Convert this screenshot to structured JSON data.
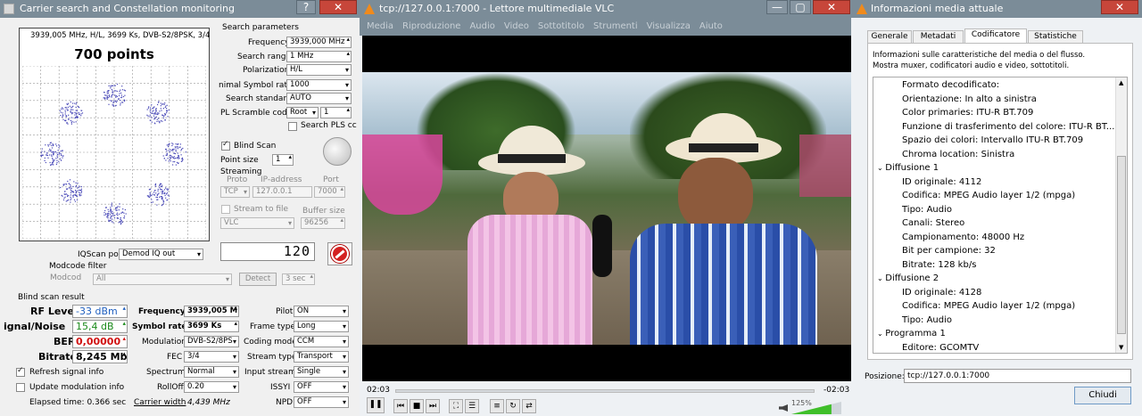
{
  "tbs": {
    "title": "Carrier search and Constellation monitoring",
    "help": "?",
    "close": "✕",
    "constellation": {
      "header": "3939,005 MHz, H/L, 3699 Ks, DVB-S2/8PSK, 3/4",
      "points": "700 points"
    },
    "search_params": {
      "title": "Search parameters",
      "frequency_label": "Frequency",
      "frequency": "3939,000 MHz",
      "search_range_label": "Search range",
      "search_range": "1 MHz",
      "polarization_label": "Polarization",
      "polarization": "H/L",
      "symbol_rate_label": "nimal Symbol rate",
      "symbol_rate": "1000",
      "search_standard_label": "Search standard",
      "search_standard": "AUTO",
      "pl_scramble_label": "PL Scramble code",
      "pl_scramble_type": "Root",
      "pl_scramble_value": "1",
      "search_pls_label": "Search PLS cc"
    },
    "blind_scan_label": "Blind Scan",
    "point_size_label": "Point size",
    "point_size": "1",
    "streaming": {
      "title": "Streaming",
      "proto_label": "Proto",
      "ip_label": "IP-address",
      "port_label": "Port",
      "proto": "TCP",
      "ip": "127.0.0.1",
      "port": "7000",
      "stream_to_file_label": "Stream to file",
      "buffer_size_label": "Buffer size",
      "player": "VLC",
      "buffer_size": "96256"
    },
    "display_value": "120",
    "iqscan_label": "IQScan point",
    "iqscan_value": "Demod IQ out",
    "modcode_filter_title": "Modcode filter",
    "modcode_label": "Modcod",
    "modcode_value": "All",
    "detect_label": "Detect",
    "detect_time": "3 sec",
    "result_title": "Blind scan result",
    "rf_level_label": "RF Level",
    "rf_level": "-33 dBm",
    "snr_label": "ignal/Noise",
    "snr": "15,4 dB",
    "ber_label": "BER",
    "ber": "0,00000",
    "bitrate_label": "Bitrate",
    "bitrate": "8,245 Mb",
    "refresh_label": "Refresh signal info",
    "update_mod_label": "Update modulation info",
    "elapsed": "Elapsed time: 0.366 sec",
    "col2": [
      {
        "label": "Frequency",
        "value": "3939,005 M"
      },
      {
        "label": "Symbol rate",
        "value": "3699 Ks"
      },
      {
        "label": "Modulation",
        "value": "DVB-S2/8PS"
      },
      {
        "label": "FEC",
        "value": "3/4"
      },
      {
        "label": "Spectrum",
        "value": "Normal"
      },
      {
        "label": "RollOff",
        "value": "0.20"
      }
    ],
    "carrier_width_label": "Carrier width",
    "carrier_width": "4,439 MHz",
    "col3": [
      {
        "label": "Pilot",
        "value": "ON"
      },
      {
        "label": "Frame type",
        "value": "Long"
      },
      {
        "label": "Coding mode",
        "value": "CCM"
      },
      {
        "label": "Stream type",
        "value": "Transport"
      },
      {
        "label": "Input stream",
        "value": "Single"
      },
      {
        "label": "ISSYI",
        "value": "OFF"
      },
      {
        "label": "NPD",
        "value": "OFF"
      }
    ],
    "colors": {
      "rf": "#1f5fbf",
      "snr": "#1a8a1a",
      "ber": "#d01010"
    }
  },
  "vlc": {
    "title": "tcp://127.0.0.1:7000 - Lettore multimediale VLC",
    "menu": [
      "Media",
      "Riproduzione",
      "Audio",
      "Video",
      "Sottotitolo",
      "Strumenti",
      "Visualizza",
      "Aiuto"
    ],
    "time_elapsed": "02:03",
    "time_remaining": "-02:03",
    "volume": "125%",
    "volume_level": 1.25
  },
  "info": {
    "title": "Informazioni media attuale",
    "tabs": [
      "Generale",
      "Metadati",
      "Codificatore",
      "Statistiche"
    ],
    "description_line1": "Informazioni sulle caratteristiche del media o del flusso.",
    "description_line2": "Mostra muxer, codificatori audio e video, sottotitoli.",
    "tree": [
      {
        "text": "Formato decodificato:",
        "level": 2
      },
      {
        "text": "Orientazione: In alto a sinistra",
        "level": 2
      },
      {
        "text": "Color primaries: ITU-R BT.709",
        "level": 2
      },
      {
        "text": "Funzione di trasferimento del colore: ITU-R BT....",
        "level": 2
      },
      {
        "text": "Spazio dei colori: Intervallo ITU-R BT.709",
        "level": 2
      },
      {
        "text": "Chroma location: Sinistra",
        "level": 2
      },
      {
        "text": "Diffusione 1",
        "level": 1
      },
      {
        "text": "ID originale: 4112",
        "level": 2
      },
      {
        "text": "Codifica: MPEG Audio layer 1/2 (mpga)",
        "level": 2
      },
      {
        "text": "Tipo: Audio",
        "level": 2
      },
      {
        "text": "Canali: Stereo",
        "level": 2
      },
      {
        "text": "Campionamento: 48000 Hz",
        "level": 2
      },
      {
        "text": "Bit per campione: 32",
        "level": 2
      },
      {
        "text": "Bitrate: 128 kb/s",
        "level": 2
      },
      {
        "text": "Diffusione 2",
        "level": 1
      },
      {
        "text": "ID originale: 4128",
        "level": 2
      },
      {
        "text": "Codifica: MPEG Audio layer 1/2 (mpga)",
        "level": 2
      },
      {
        "text": "Tipo: Audio",
        "level": 2
      },
      {
        "text": "Programma 1",
        "level": 1
      },
      {
        "text": "Editore: GCOMTV",
        "level": 2
      }
    ],
    "position_label": "Posizione:",
    "position": "tcp://127.0.0.1:7000",
    "close_button": "Chiudi"
  }
}
